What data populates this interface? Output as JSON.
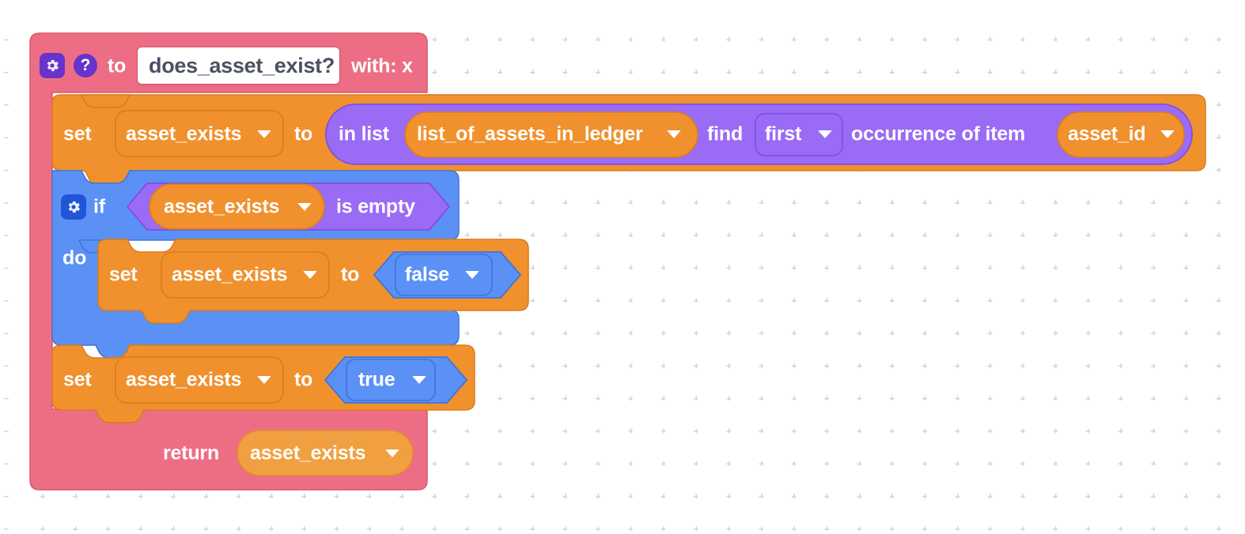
{
  "workspace": {
    "background_color": "#ffffff",
    "grid_dot_color": "#d4d4d4",
    "grid_spacing_px": 41
  },
  "palette": {
    "function_pink": "#ED6E84",
    "function_pink_border": "#d8566c",
    "variable_orange": "#F0912D",
    "variable_orange_border": "#d97c1c",
    "list_purple": "#9A6BF5",
    "list_purple_border": "#7d4fe0",
    "logic_blue": "#5B91F5",
    "logic_blue_border": "#3f74d8",
    "icon_purple": "#6733CC",
    "icon_blue": "#2255D6",
    "field_text_dark": "#4b5163",
    "block_text_white": "#ffffff"
  },
  "function_block": {
    "name": "function-definition-block",
    "gear_icon": "gear-icon",
    "help_icon": "question-mark-icon",
    "to_label": "to",
    "function_name": "does_asset_exist?",
    "params_label": "with: x",
    "return_label": "return",
    "return_value": "asset_exists",
    "return_value_caret": "chevron-down-icon"
  },
  "statement_set_find": {
    "name": "set-asset-exists-find-block",
    "set_label": "set",
    "variable": "asset_exists",
    "variable_caret": "chevron-down-icon",
    "to_label": "to",
    "value": {
      "name": "list-index-of-block",
      "in_list_label": "in list",
      "list_variable": "list_of_assets_in_ledger",
      "list_variable_caret": "chevron-down-icon",
      "find_label": "find",
      "occurrence": "first",
      "occurrence_caret": "chevron-down-icon",
      "occurrence_of_item_label": "occurrence of item",
      "item_variable": "asset_id",
      "item_variable_caret": "chevron-down-icon"
    }
  },
  "if_block": {
    "name": "if-block",
    "gear_icon": "gear-icon",
    "if_label": "if",
    "do_label": "do",
    "condition": {
      "name": "is-empty-block",
      "variable": "asset_exists",
      "variable_caret": "chevron-down-icon",
      "predicate_label": "is empty"
    },
    "body": {
      "name": "set-asset-exists-false-block",
      "set_label": "set",
      "variable": "asset_exists",
      "variable_caret": "chevron-down-icon",
      "to_label": "to",
      "value": "false",
      "value_caret": "chevron-down-icon"
    }
  },
  "statement_set_true": {
    "name": "set-asset-exists-true-block",
    "set_label": "set",
    "variable": "asset_exists",
    "variable_caret": "chevron-down-icon",
    "to_label": "to",
    "value": "true",
    "value_caret": "chevron-down-icon"
  }
}
